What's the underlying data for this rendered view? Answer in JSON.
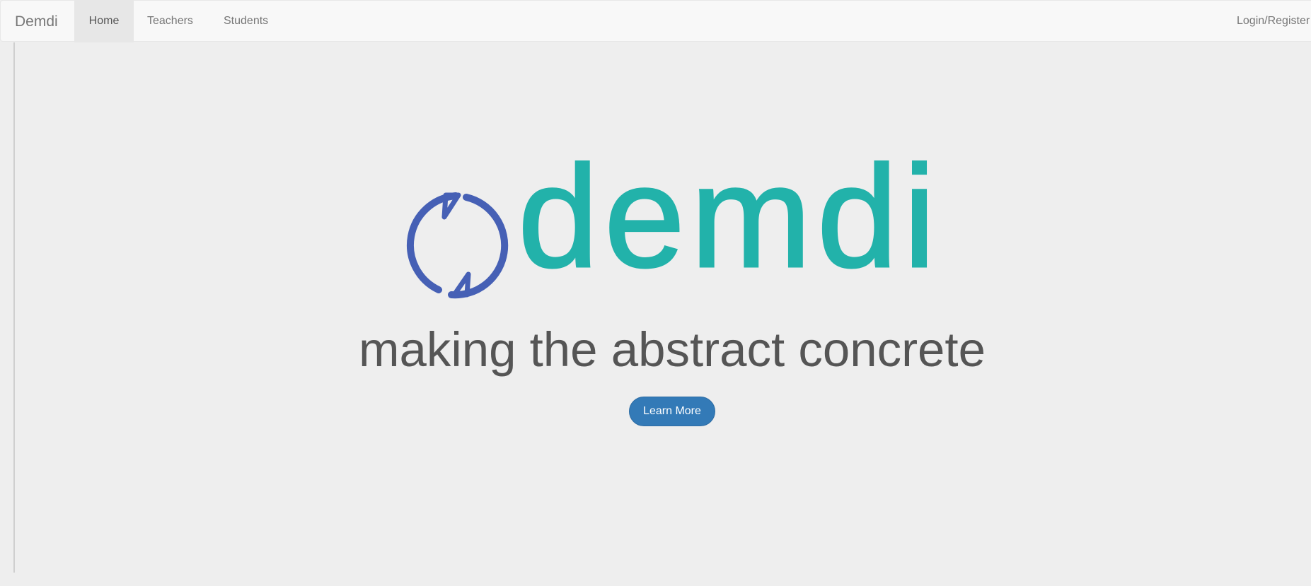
{
  "navbar": {
    "brand": "Demdi",
    "items": [
      {
        "label": "Home",
        "active": true
      },
      {
        "label": "Teachers",
        "active": false
      },
      {
        "label": "Students",
        "active": false
      }
    ],
    "login_label": "Login/Register"
  },
  "hero": {
    "logo_text": "demdi",
    "logo_icon": "refresh-cycle-icon",
    "tagline": "making the abstract concrete",
    "button_label": "Learn More"
  },
  "colors": {
    "logo_teal": "#22b2aa",
    "logo_blue": "#4660b5",
    "button": "#337ab7",
    "background": "#eeeeee"
  }
}
